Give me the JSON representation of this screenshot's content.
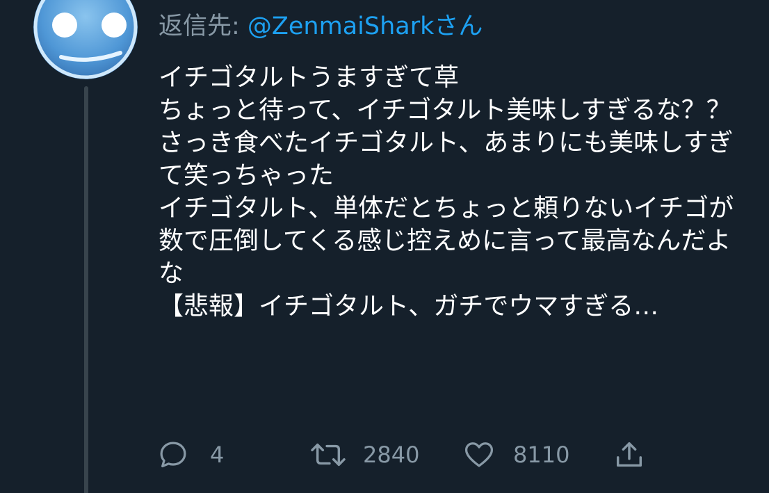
{
  "reply": {
    "prefix": "返信先: ",
    "handle": "@ZenmaiShark",
    "suffix": "さん"
  },
  "tweet": {
    "text": "イチゴタルトうますぎて草\nちょっと待って、イチゴタルト美味しすぎるな？？\nさっき食べたイチゴタルト、あまりにも美味しすぎて笑っちゃった\nイチゴタルト、単体だとちょっと頼りないイチゴが数で圧倒してくる感じ控えめに言って最高なんだよな\n【悲報】イチゴタルト、ガチでウマすぎる…"
  },
  "actions": {
    "reply_count": "4",
    "retweet_count": "2840",
    "like_count": "8110"
  },
  "colors": {
    "background": "#15202b",
    "secondary_text": "#8899a6",
    "link": "#1da1f2",
    "thread_line": "#38444d"
  },
  "icons": {
    "reply": "speech-bubble-icon",
    "retweet": "retweet-arrows-icon",
    "like": "heart-outline-icon",
    "share": "share-upload-icon"
  }
}
